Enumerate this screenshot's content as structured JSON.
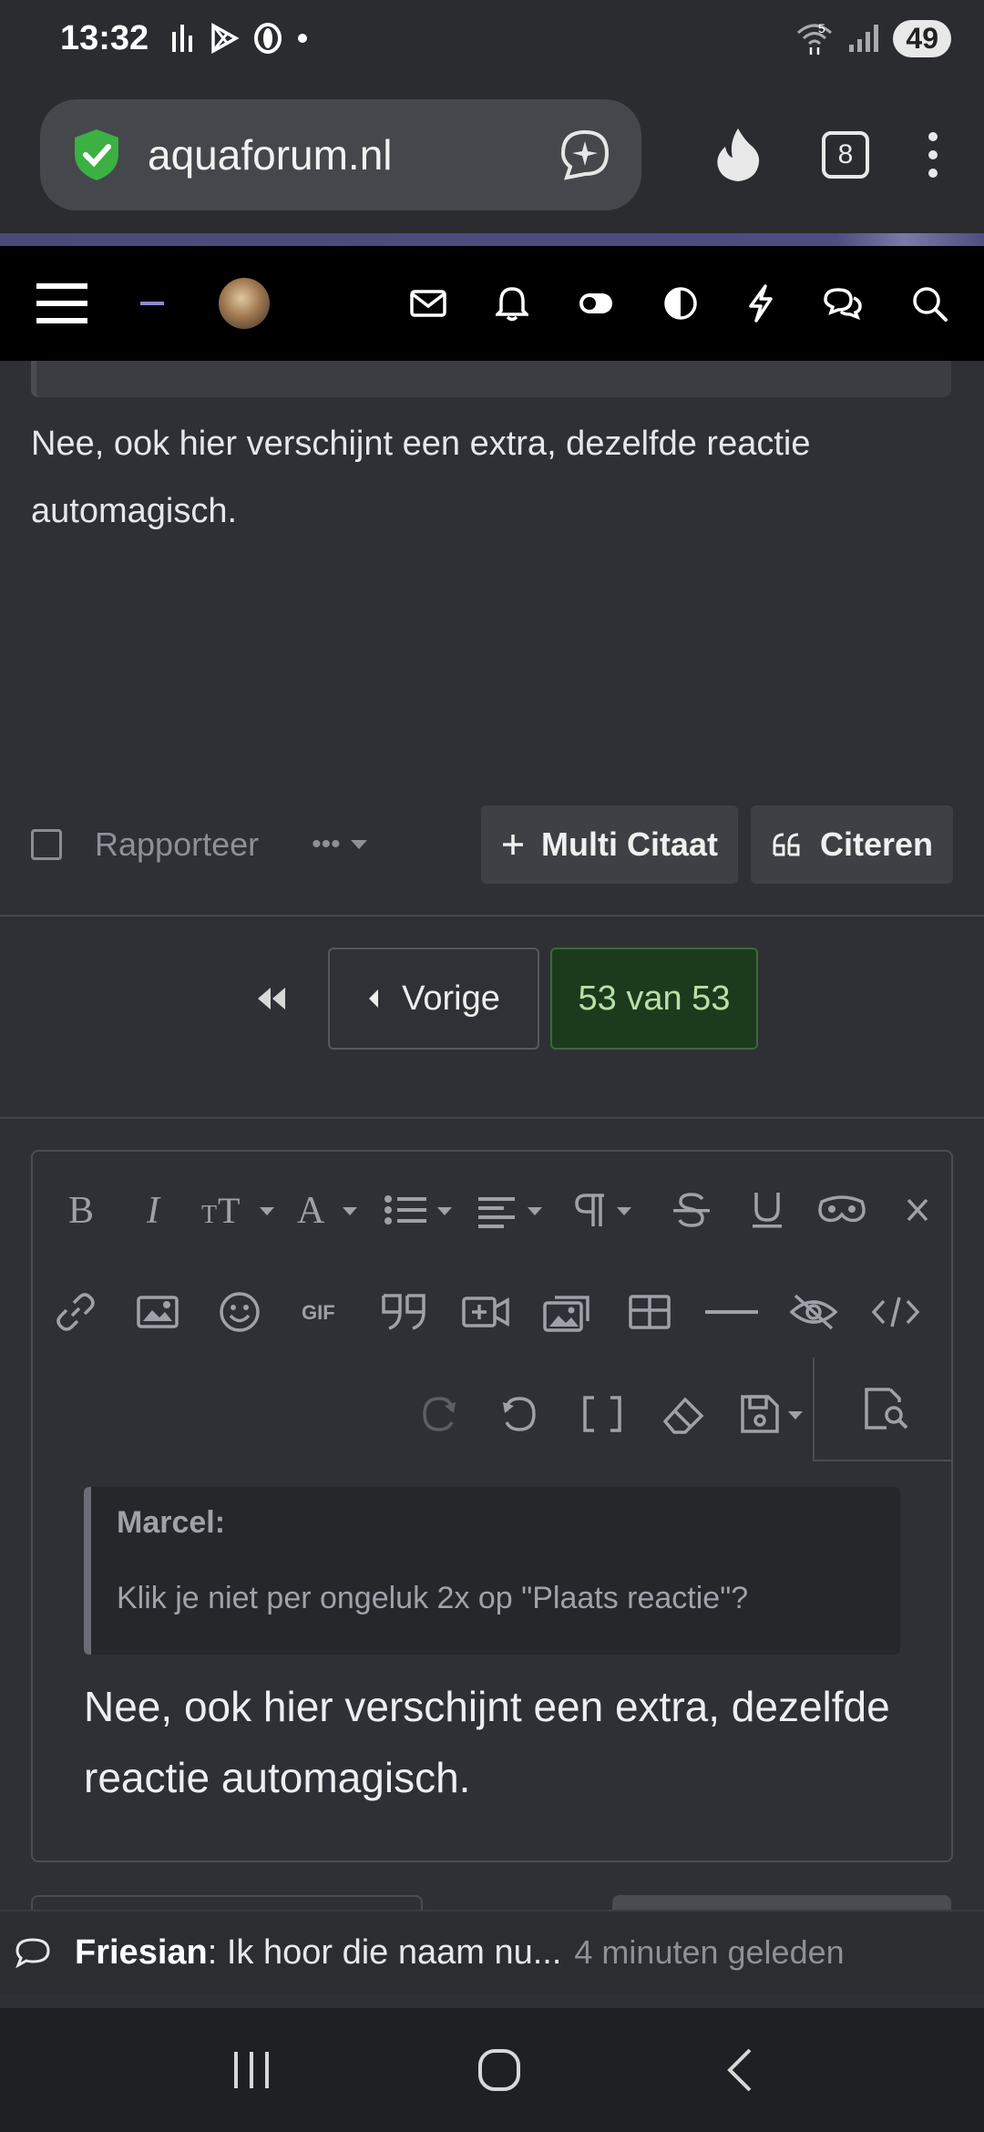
{
  "status_bar": {
    "time": "13:32",
    "battery": "49",
    "network_badge": "5"
  },
  "browser": {
    "url": "aquaforum.nl",
    "tabs_count": "8"
  },
  "post": {
    "text": "Nee, ook hier verschijnt een extra, dezelfde reactie automagisch.",
    "report_label": "Rapporteer",
    "more_label": "•••",
    "multi_quote_label": "Multi Citaat",
    "quote_label": "Citeren"
  },
  "pagination": {
    "prev_label": "Vorige",
    "current_label": "53 van 53"
  },
  "editor": {
    "quote_author": "Marcel:",
    "quote_text": "Klik je niet per ongeluk 2x op \"Plaats reactie\"?",
    "body_text": "Nee, ook hier verschijnt een extra, dezelfde reactie automagisch."
  },
  "notification": {
    "user": "Friesian",
    "message": ": Ik hoor die naam nu...",
    "time": "4 minuten geleden"
  }
}
